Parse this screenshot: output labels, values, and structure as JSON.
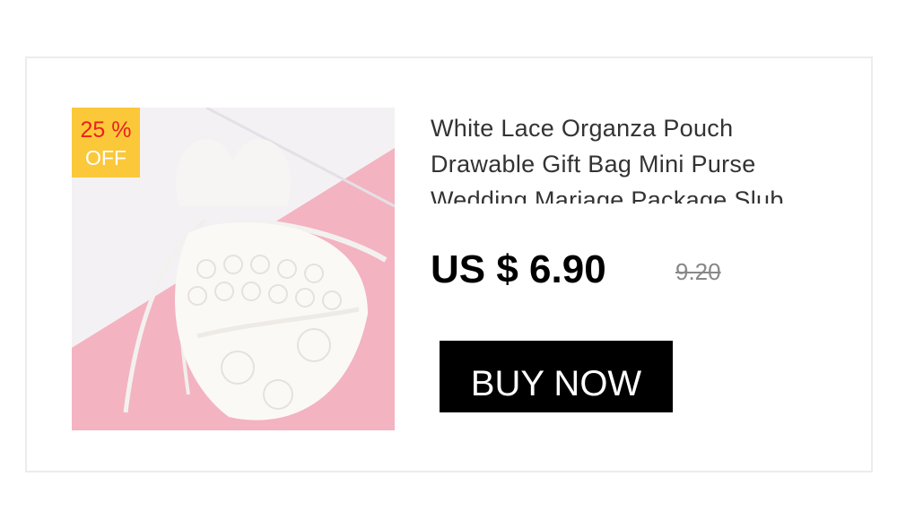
{
  "product": {
    "title": "White Lace Organza Pouch Drawable Gift Bag Mini Purse Wedding Mariage Package Slub",
    "image_alt": "white lace drawstring pouch"
  },
  "badge": {
    "percent": "25 %",
    "label": "OFF"
  },
  "pricing": {
    "current": "US $ 6.90",
    "original": "9.20"
  },
  "actions": {
    "buy_label": "BUY NOW"
  },
  "colors": {
    "badge_bg": "#fbc83a",
    "badge_percent": "#e8231f",
    "button_bg": "#000000",
    "image_bg": "#f3b3c1"
  }
}
